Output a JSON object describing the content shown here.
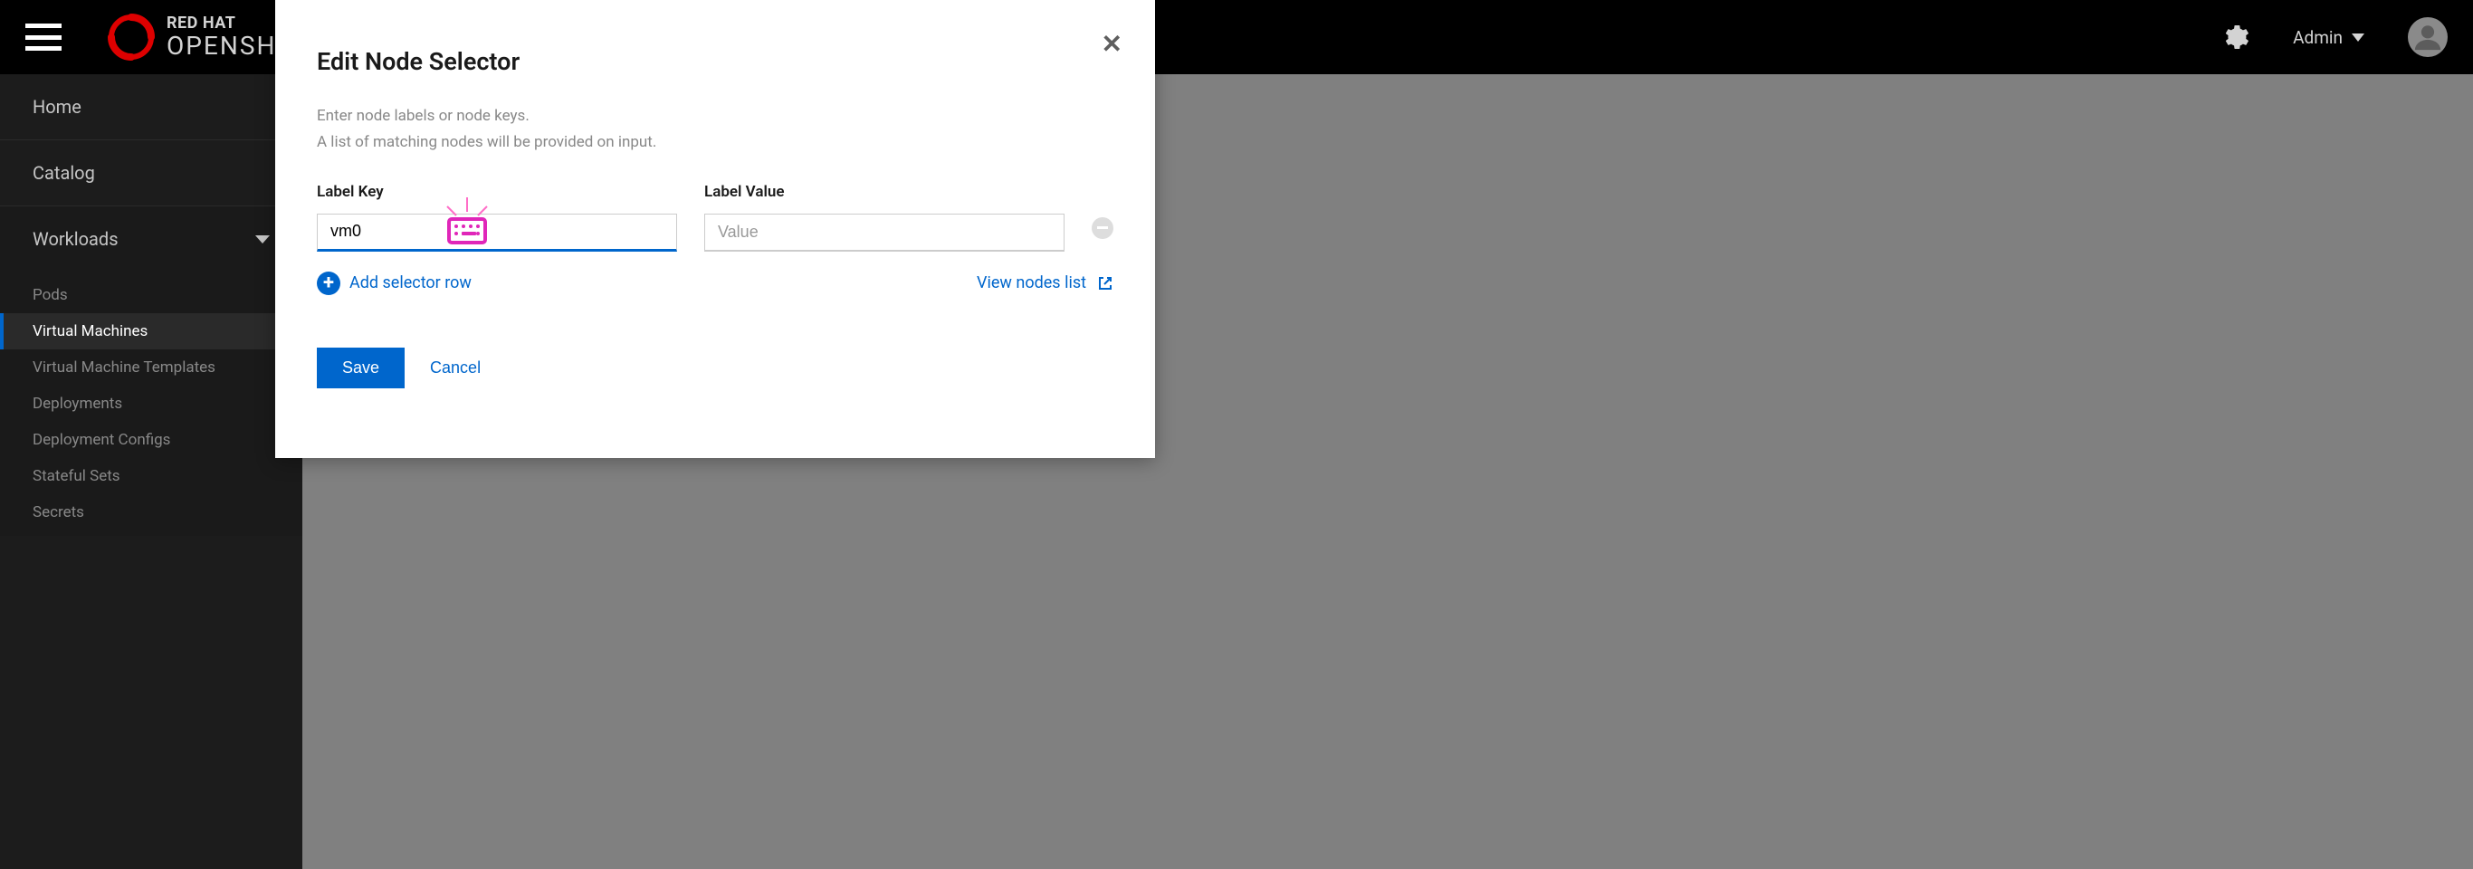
{
  "header": {
    "logo_top": "RED HAT",
    "logo_bottom": "OPENSHIFT",
    "admin_label": "Admin"
  },
  "sidebar": {
    "items": [
      {
        "label": "Home"
      },
      {
        "label": "Catalog"
      },
      {
        "label": "Workloads",
        "expanded": true
      }
    ],
    "subitems": [
      {
        "label": "Pods"
      },
      {
        "label": "Virtual Machines",
        "active": true
      },
      {
        "label": "Virtual Machine Templates"
      },
      {
        "label": "Deployments"
      },
      {
        "label": "Deployment Configs"
      },
      {
        "label": "Stateful Sets"
      },
      {
        "label": "Secrets"
      }
    ]
  },
  "modal": {
    "title": "Edit Node Selector",
    "desc_line1": "Enter node labels or node keys.",
    "desc_line2": "A list of matching nodes will be provided on input.",
    "label_key_label": "Label Key",
    "label_value_label": "Label Value",
    "label_key_value": "vm0",
    "label_value_value": "",
    "label_value_placeholder": "Value",
    "add_row": "Add selector row",
    "view_nodes": "View nodes list",
    "save": "Save",
    "cancel": "Cancel"
  }
}
